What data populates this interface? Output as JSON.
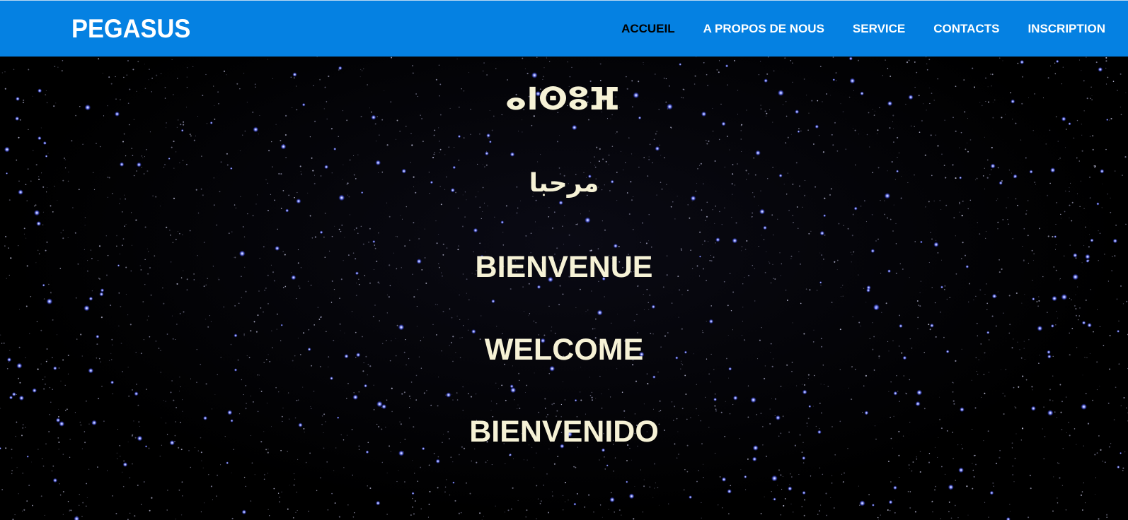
{
  "navbar": {
    "brand": "PEGASUS",
    "links": [
      {
        "label": "ACCUEIL",
        "active": true
      },
      {
        "label": "A PROPOS DE NOUS",
        "active": false
      },
      {
        "label": "SERVICE",
        "active": false
      },
      {
        "label": "CONTACTS",
        "active": false
      },
      {
        "label": "INSCRIPTION",
        "active": false
      }
    ]
  },
  "hero": {
    "greetings": {
      "tifinagh": "ⴰⵏⵙⵓⴼ",
      "arabic": "مرحبا",
      "french": "BIENVENUE",
      "english": "WELCOME",
      "spanish": "BIENVENIDO"
    },
    "background": "starfield"
  },
  "colors": {
    "navbar_bg": "#0581e2",
    "nav_text": "#ffffff",
    "nav_active_text": "#000000",
    "greeting_text": "#f6f2d6",
    "star_blue": "#5a6cff"
  }
}
